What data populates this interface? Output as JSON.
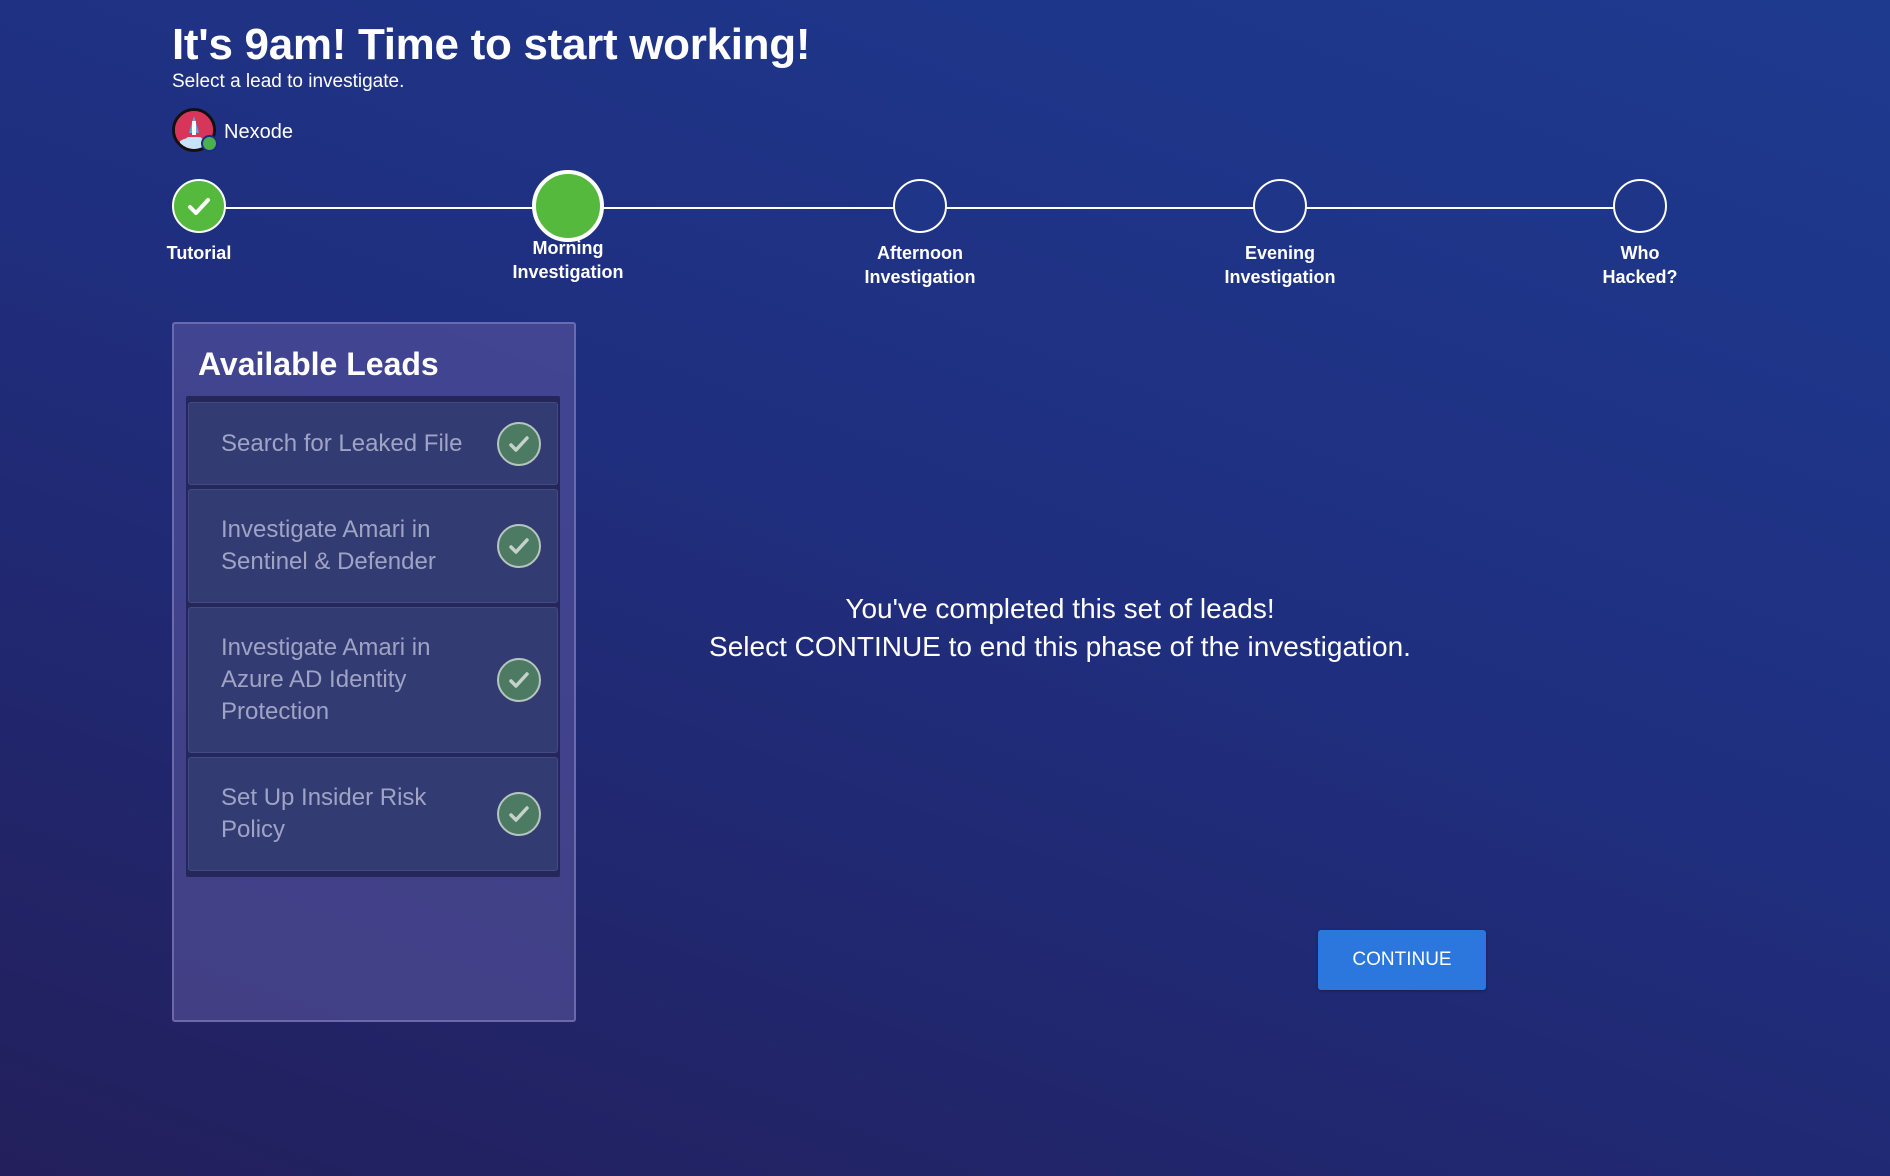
{
  "header": {
    "title": "It's 9am! Time to start working!",
    "subtitle": "Select a lead to investigate."
  },
  "user": {
    "name": "Nexode",
    "avatar_icon": "rocket-avatar-icon",
    "status": "online"
  },
  "stepper": {
    "steps": [
      {
        "label": "Tutorial",
        "state": "completed"
      },
      {
        "label": "Morning\nInvestigation",
        "state": "active"
      },
      {
        "label": "Afternoon\nInvestigation",
        "state": "upcoming"
      },
      {
        "label": "Evening\nInvestigation",
        "state": "upcoming"
      },
      {
        "label": "Who\nHacked?",
        "state": "upcoming"
      }
    ]
  },
  "leads": {
    "title": "Available Leads",
    "items": [
      {
        "label": "Search for Leaked File",
        "status": "completed"
      },
      {
        "label": "Investigate Amari in Sentinel & Defender",
        "status": "completed"
      },
      {
        "label": "Investigate Amari in Azure AD Identity Protection",
        "status": "completed"
      },
      {
        "label": "Set Up Insider Risk Policy",
        "status": "completed"
      }
    ]
  },
  "completion": {
    "line1": "You've completed this set of leads!",
    "line2": "Select CONTINUE to end this phase of the investigation."
  },
  "continue_label": "CONTINUE",
  "colors": {
    "completed_green": "#55b93e",
    "button_blue": "#2b77de",
    "check_green": "#4c7a62"
  }
}
